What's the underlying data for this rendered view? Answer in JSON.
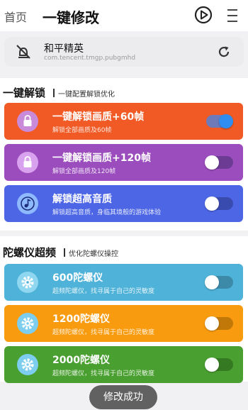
{
  "header": {
    "home": "首页",
    "title": "一键修改",
    "icons": [
      "play-circle-icon",
      "menu-icon"
    ]
  },
  "app": {
    "name": "和平精英",
    "package": "com.tencent.tmgp.pubgmhd",
    "icons": [
      "app-disabled-icon",
      "refresh-icon"
    ]
  },
  "sections": [
    {
      "title": "一键解锁",
      "subtitle": "一键配置解锁优化",
      "items": [
        {
          "title": "一键解锁画质+60帧",
          "desc": "解锁全部画质及60帧",
          "color": "#f15a24",
          "icon": "lock-icon",
          "on": true
        },
        {
          "title": "一键解锁画质+120帧",
          "desc": "解锁全部画质及120帧",
          "color": "#9b4dbd",
          "icon": "lock-icon",
          "on": false
        },
        {
          "title": "解锁超高音质",
          "desc": "解锁超高音质，身临其境般的游戏体验",
          "color": "#4d66e6",
          "icon": "music-note-icon",
          "on": false
        }
      ]
    },
    {
      "title": "陀螺仪超频",
      "subtitle": "优化陀螺仪操控",
      "items": [
        {
          "title": "600陀螺仪",
          "desc": "超频陀螺仪，找寻属于自己的灵敏度",
          "color": "#4fb2d8",
          "icon": "gear-icon",
          "on": false
        },
        {
          "title": "1200陀螺仪",
          "desc": "超频陀螺仪，找寻属于自己的灵敏度",
          "color": "#f99b0f",
          "icon": "gear-icon",
          "on": false
        },
        {
          "title": "2000陀螺仪",
          "desc": "超频陀螺仪，找寻属于自己的灵敏度",
          "color": "#4a9f31",
          "icon": "gear-icon",
          "on": false
        }
      ]
    }
  ],
  "toast": "修改成功"
}
